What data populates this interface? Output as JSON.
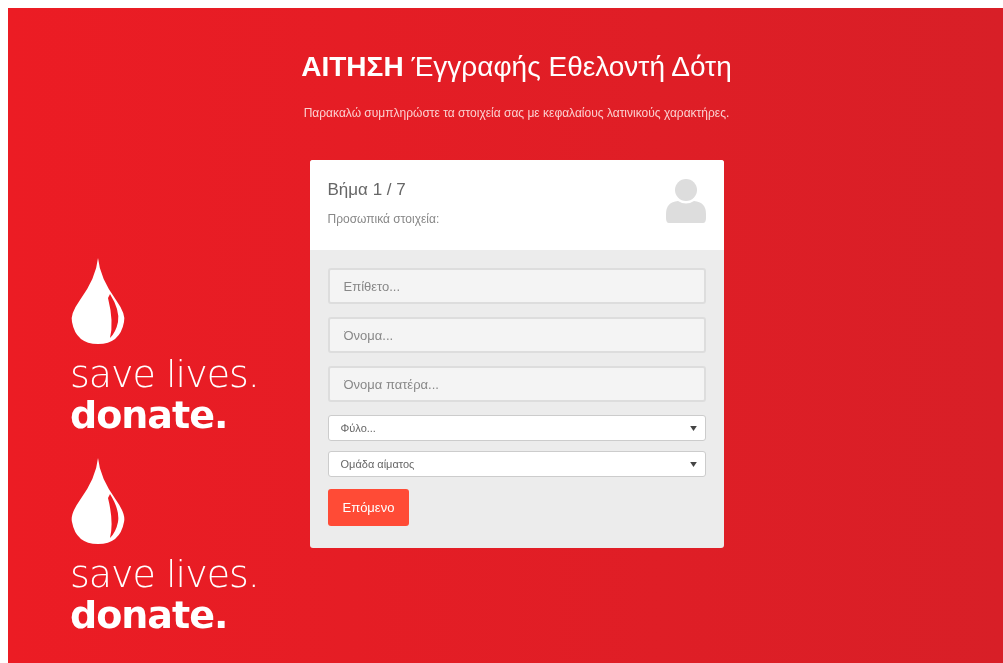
{
  "header": {
    "title_bold": "ΑΙΤΗΣΗ",
    "title": "Έγγραφής Εθελοντή Δότη",
    "subtitle": "Παρακαλώ συμπληρώστε τα στοιχεία σας με κεφαλαίους λατινικούς χαρακτήρες."
  },
  "promos": [
    {
      "line1": "save lives.",
      "line2": "donate."
    },
    {
      "line1": "save lives.",
      "line2": "donate."
    }
  ],
  "card": {
    "step": "Βήμα 1 / 7",
    "section": "Προσωπικά στοιχεία:",
    "fields": [
      {
        "kind": "text",
        "placeholder": "Επίθετο..."
      },
      {
        "kind": "text",
        "placeholder": "Όνομα..."
      },
      {
        "kind": "text",
        "placeholder": "Όνομα πατέρα..."
      },
      {
        "kind": "select",
        "value": "Φύλο..."
      },
      {
        "kind": "select",
        "value": "Ομάδα αίματος"
      }
    ],
    "button": "Επόμενο"
  }
}
